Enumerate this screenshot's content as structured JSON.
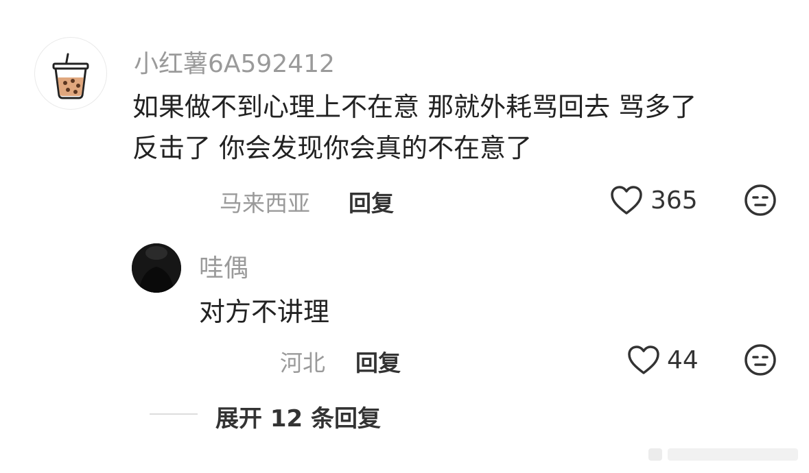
{
  "comment": {
    "username": "小红薯6A592412",
    "text_line1": "如果做不到心理上不在意 那就外耗骂回去 骂多了",
    "text_line2": "反击了 你会发现你会真的不在意了",
    "location": "马来西亚",
    "reply_label": "回复",
    "likes": "365",
    "avatar_icon": "bubble-tea-icon",
    "like_icon": "heart-outline-icon",
    "reaction_icon": "neutral-face-icon"
  },
  "reply": {
    "username": "哇偶",
    "text": "对方不讲理",
    "location": "河北",
    "reply_label": "回复",
    "likes": "44",
    "like_icon": "heart-outline-icon",
    "reaction_icon": "neutral-face-icon"
  },
  "expand": {
    "label": "展开 12 条回复"
  },
  "colors": {
    "primary_text": "#222222",
    "secondary_text": "#9a9a9a",
    "tea": "#d9a27a",
    "divider": "#dddddd"
  }
}
